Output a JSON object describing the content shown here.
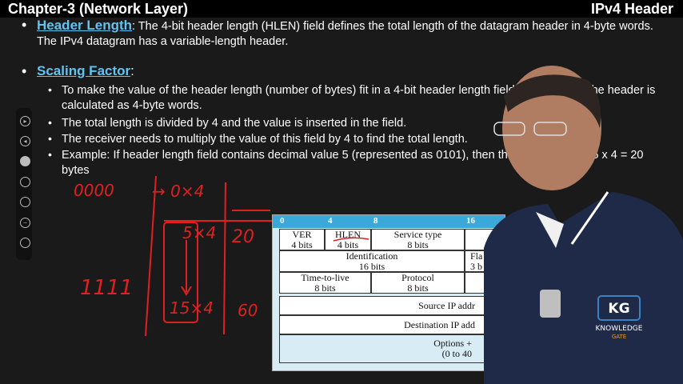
{
  "header": {
    "chapter": "Chapter-3 (Network Layer)",
    "topic": "IPv4 Header"
  },
  "slide": {
    "header_length_title": "Header Length",
    "header_length_text": ": The 4-bit header length (HLEN) field defines the total length of the datagram header in 4-byte words. The IPv4 datagram has a variable-length header.",
    "scaling_title": "Scaling Factor",
    "scaling_colon": ":",
    "sub_bullets": [
      "To make the value of the header length (number of bytes) fit in a 4-bit header length field, the length of the header is calculated as 4-byte words.",
      "The total length is divided by 4 and the value is inserted in the field.",
      "The receiver needs to multiply the value of this field by 4 to find the total length.",
      "Example: If header length field contains decimal value 5 (represented as 0101), then the header size is 5 x 4 = 20 bytes"
    ]
  },
  "annotations": {
    "binary_zero": "0000",
    "arrow_zero": "→ 0×4",
    "row_5": "5×4",
    "val_20": "20",
    "binary_ones": "1111",
    "row_15": "15×4",
    "val_60": "60"
  },
  "table": {
    "bit_labels": [
      "0",
      "4",
      "8",
      "16"
    ],
    "row1": [
      {
        "name": "VER",
        "bits": "4 bits"
      },
      {
        "name": "HLEN",
        "bits": "4 bits"
      },
      {
        "name": "Service type",
        "bits": "8 bits"
      }
    ],
    "row2": {
      "name": "Identification",
      "bits": "16 bits",
      "flag_name": "Fla",
      "flag_bits": "3 b"
    },
    "row3": [
      {
        "name": "Time-to-live",
        "bits": "8 bits"
      },
      {
        "name": "Protocol",
        "bits": "8 bits"
      }
    ],
    "source": "Source IP addr",
    "destination": "Destination IP add",
    "options": "Options + ",
    "options_sub": "(0 to 40"
  },
  "logo": {
    "letters": "KG",
    "name": "KNOWLEDGE",
    "sub": "GATE"
  },
  "colors": {
    "heading": "#5fc4f2",
    "ink": "#e02020",
    "table_header": "#3aa8d8"
  }
}
